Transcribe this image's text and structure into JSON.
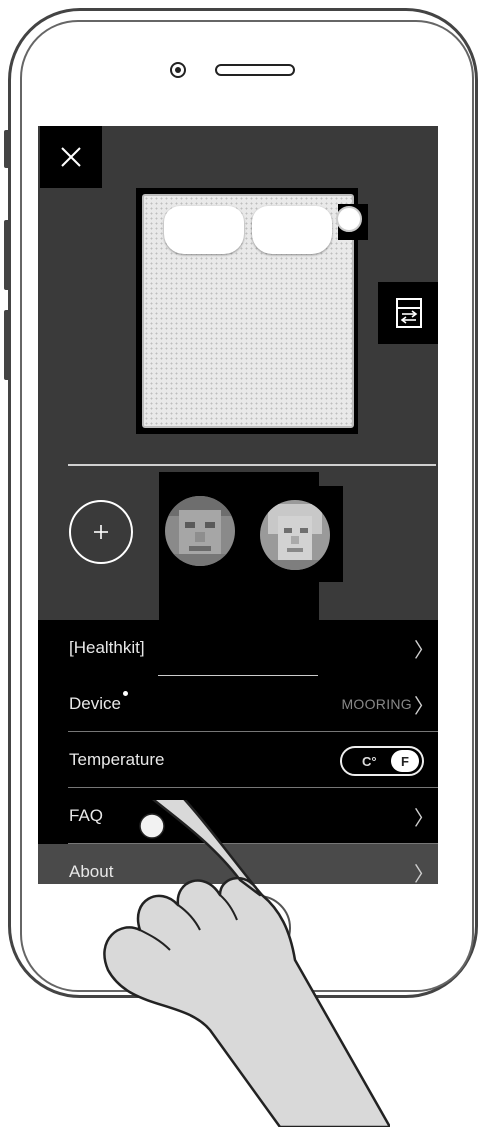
{
  "header": {
    "close_icon": "close-icon"
  },
  "bed": {
    "swap_icon": "swap-sides-icon"
  },
  "profiles": {
    "add_icon": "plus-icon"
  },
  "menu": {
    "healthkit": {
      "label": "[Healthkit]"
    },
    "device": {
      "label": "Device",
      "value": "MOORING"
    },
    "temperature": {
      "label": "Temperature",
      "option_c": "C°",
      "option_f": "F"
    },
    "faq": {
      "label": "FAQ"
    },
    "about": {
      "label": "About"
    },
    "chevron": "〉"
  }
}
